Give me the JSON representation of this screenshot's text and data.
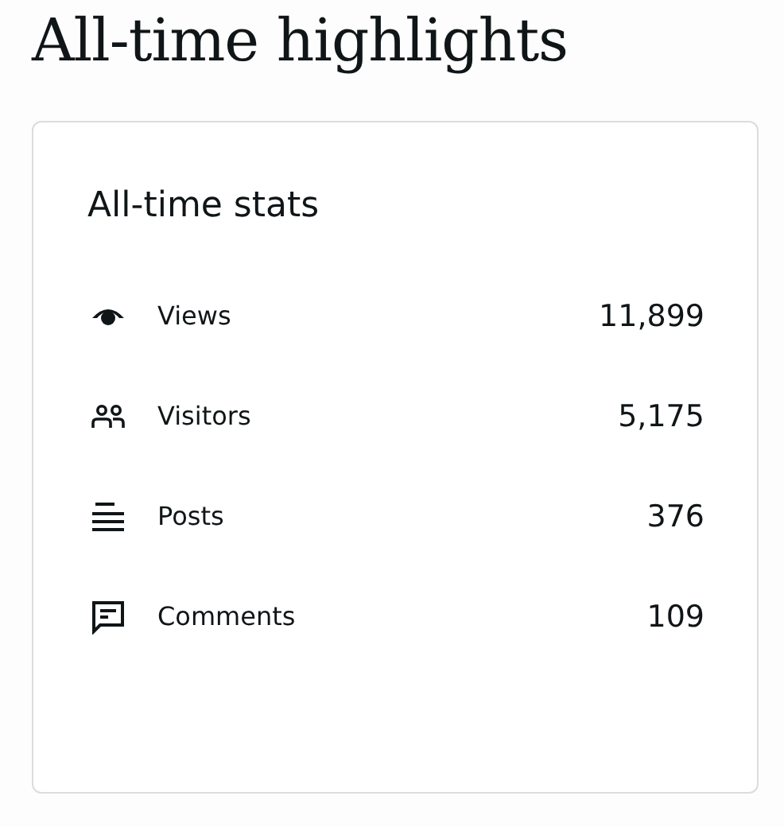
{
  "heading": "All-time highlights",
  "card": {
    "title": "All-time stats",
    "stats": [
      {
        "kind": "views",
        "label": "Views",
        "value": "11,899"
      },
      {
        "kind": "visitors",
        "label": "Visitors",
        "value": "5,175"
      },
      {
        "kind": "posts",
        "label": "Posts",
        "value": "376"
      },
      {
        "kind": "comments",
        "label": "Comments",
        "value": "109"
      }
    ]
  }
}
